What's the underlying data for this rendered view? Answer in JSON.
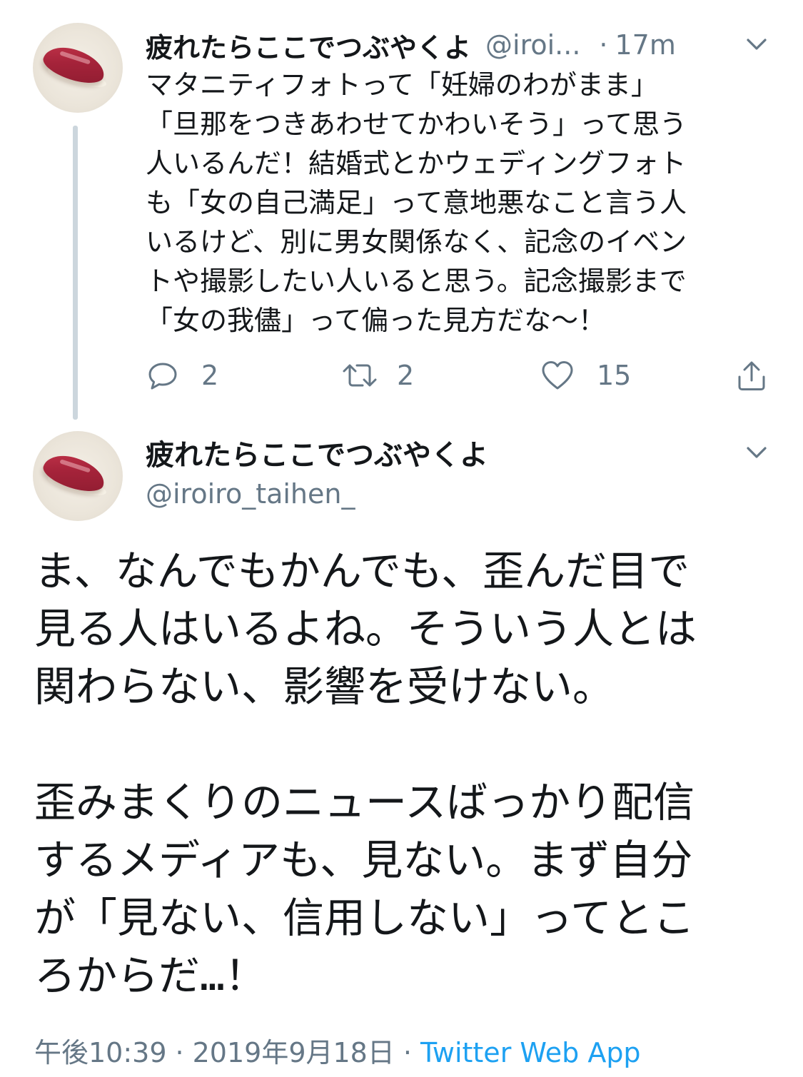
{
  "colors": {
    "primary_text": "#14171a",
    "secondary_text": "#657786",
    "link": "#1da1f2",
    "thread_line": "#ccd6dd"
  },
  "tweet1": {
    "display_name": "疲れたらここでつぶやくよ",
    "handle_truncated": "@iroi...",
    "separator": "·",
    "time": "17m",
    "body": "マタニティフォトって「妊婦のわがまま」\n「旦那をつきあわせてかわいそう」って思う\n人いるんだ！結婚式とかウェディングフォト\nも「女の自己満足」って意地悪なこと言う人\nいるけど、別に男女関係なく、記念のイベン\nトや撮影したい人いると思う。記念撮影まで\n「女の我儘」って偏った見方だな〜！",
    "actions": {
      "reply": {
        "icon": "reply-icon",
        "count": "2"
      },
      "retweet": {
        "icon": "retweet-icon",
        "count": "2"
      },
      "like": {
        "icon": "heart-icon",
        "count": "15"
      },
      "share": {
        "icon": "share-icon"
      }
    },
    "menu_icon": "chevron-down-icon"
  },
  "tweet2": {
    "display_name": "疲れたらここでつぶやくよ",
    "handle": "@iroiro_taihen_",
    "body": "ま、なんでもかんでも、歪んだ目で\n見る人はいるよね。そういう人とは\n関わらない、影響を受けない。\n\n歪みまくりのニュースばっかり配信\nするメディアも、見ない。まず自分\nが「見ない、信用しない」ってとこ\nろからだ…！",
    "menu_icon": "chevron-down-icon",
    "meta": {
      "time": "午後10:39",
      "separator": "·",
      "date": "2019年9月18日",
      "source": "Twitter Web App"
    }
  }
}
